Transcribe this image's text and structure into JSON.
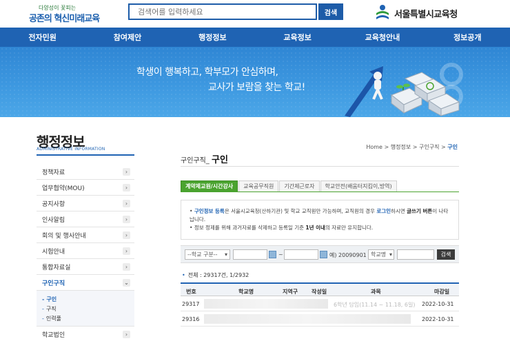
{
  "header": {
    "slogan_top": "다양성이 꽃피는",
    "slogan_main": "공존의 혁신미래교육",
    "search_placeholder": "검색어를 입력하세요",
    "search_button": "검색",
    "brand_name": "서울특별시교육청"
  },
  "nav": [
    "전자민원",
    "참여제안",
    "행정정보",
    "교육정보",
    "교육청안내",
    "정보공개"
  ],
  "banner": {
    "line1": "학생이 행복하고, 학부모가 안심하며,",
    "line2": "교사가 보람을 찾는 학교!"
  },
  "sidebar": {
    "title": "행정정보",
    "subtitle": "ADMINISTRATIVE INFORMATION",
    "items_top": [
      "정책자료",
      "업무협약(MOU)",
      "공지사항",
      "인사알림",
      "회의 및 행사안내",
      "시험안내",
      "통합자료실"
    ],
    "active_item": "구인구직",
    "sub_items": [
      "구인",
      "구직",
      "인력풀"
    ],
    "items_bottom": [
      "학교법인"
    ]
  },
  "breadcrumb": {
    "home": "Home",
    "sep": ">",
    "l1": "행정정보",
    "l2": "구인구직",
    "current": "구인"
  },
  "page": {
    "title_prefix": "구인구직_",
    "title_main": "구인"
  },
  "tabs": [
    "계약제교원/시간강사",
    "교육공무직원",
    "기간제근로자",
    "학교안전(배움터지킴이,방역)"
  ],
  "notice": {
    "l1_a": "구인정보 등록",
    "l1_b": "은 서울시교육청(산하기관) 및 학교 교직원만 가능하며, 교직원의 경우 ",
    "l1_c": "로그인",
    "l1_d": "하시면 ",
    "l1_e": "글쓰기 버튼",
    "l1_f": "이 나타납니다.",
    "l2_a": "정보 정제를 위해 과거자료를 삭제하고 등록일 기준 ",
    "l2_b": "1년 이내",
    "l2_c": "의 자료만 유지합니다."
  },
  "filter": {
    "school_type": "--학교 구분--",
    "tilde": "~",
    "example": "예) 20090901",
    "school_name": "학교명",
    "search_button": "검색"
  },
  "total": {
    "label": "전체 : 29317건, 1/2932"
  },
  "table": {
    "headers": [
      "번호",
      "학교명",
      "지역구",
      "작성일",
      "과목",
      "마감일"
    ],
    "rows": [
      {
        "no": "29317",
        "subject": "6학년 담임(11.14 ~ 11.18, 6일)",
        "deadline": "2022-10-31"
      },
      {
        "no": "29316",
        "subject": "",
        "deadline": "2022-10-31"
      }
    ]
  },
  "colors": {
    "primary": "#1f63b3",
    "tab_active": "#4aa32f",
    "nav": "#1f63b3"
  }
}
